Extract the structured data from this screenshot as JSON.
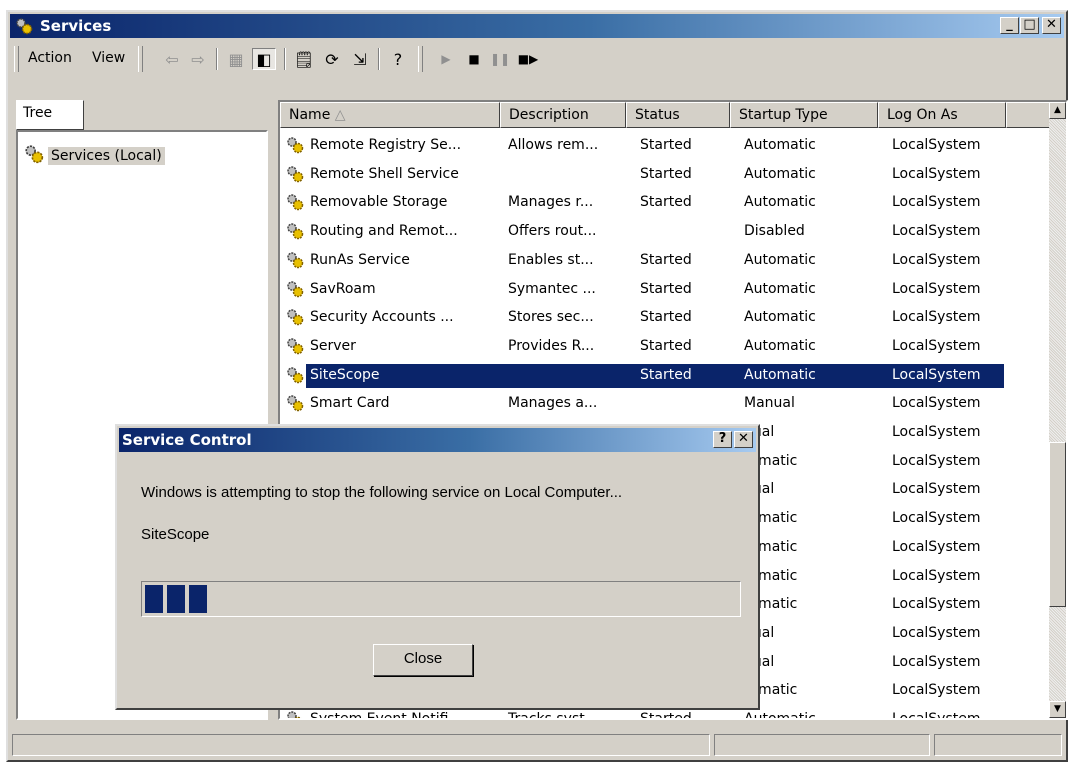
{
  "window": {
    "title": "Services"
  },
  "menu": {
    "action": "Action",
    "view": "View"
  },
  "tree": {
    "tab": "Tree",
    "root": "Services (Local)"
  },
  "columns": [
    "Name",
    "Description",
    "Status",
    "Startup Type",
    "Log On As"
  ],
  "rows": [
    {
      "name": "Remote Registry Se...",
      "desc": "Allows rem...",
      "status": "Started",
      "startup": "Automatic",
      "logon": "LocalSystem"
    },
    {
      "name": "Remote Shell Service",
      "desc": "",
      "status": "Started",
      "startup": "Automatic",
      "logon": "LocalSystem"
    },
    {
      "name": "Removable Storage",
      "desc": "Manages r...",
      "status": "Started",
      "startup": "Automatic",
      "logon": "LocalSystem"
    },
    {
      "name": "Routing and Remot...",
      "desc": "Offers rout...",
      "status": "",
      "startup": "Disabled",
      "logon": "LocalSystem"
    },
    {
      "name": "RunAs Service",
      "desc": "Enables st...",
      "status": "Started",
      "startup": "Automatic",
      "logon": "LocalSystem"
    },
    {
      "name": "SavRoam",
      "desc": "Symantec ...",
      "status": "Started",
      "startup": "Automatic",
      "logon": "LocalSystem"
    },
    {
      "name": "Security Accounts ...",
      "desc": "Stores sec...",
      "status": "Started",
      "startup": "Automatic",
      "logon": "LocalSystem"
    },
    {
      "name": "Server",
      "desc": "Provides R...",
      "status": "Started",
      "startup": "Automatic",
      "logon": "LocalSystem"
    },
    {
      "name": "SiteScope",
      "desc": "",
      "status": "Started",
      "startup": "Automatic",
      "logon": "LocalSystem",
      "selected": true
    },
    {
      "name": "Smart Card",
      "desc": "Manages a...",
      "status": "",
      "startup": "Manual",
      "logon": "LocalSystem"
    },
    {
      "name": "",
      "desc": "",
      "status": "",
      "startup": "nual",
      "logon": "LocalSystem"
    },
    {
      "name": "",
      "desc": "",
      "status": "",
      "startup": "tomatic",
      "logon": "LocalSystem"
    },
    {
      "name": "",
      "desc": "",
      "status": "",
      "startup": "nual",
      "logon": "LocalSystem"
    },
    {
      "name": "",
      "desc": "",
      "status": "",
      "startup": "tomatic",
      "logon": "LocalSystem"
    },
    {
      "name": "",
      "desc": "",
      "status": "",
      "startup": "tomatic",
      "logon": "LocalSystem"
    },
    {
      "name": "",
      "desc": "",
      "status": "",
      "startup": "tomatic",
      "logon": "LocalSystem"
    },
    {
      "name": "",
      "desc": "",
      "status": "",
      "startup": "tomatic",
      "logon": "LocalSystem"
    },
    {
      "name": "",
      "desc": "",
      "status": "",
      "startup": "nual",
      "logon": "LocalSystem"
    },
    {
      "name": "",
      "desc": "",
      "status": "",
      "startup": "nual",
      "logon": "LocalSystem"
    },
    {
      "name": "",
      "desc": "",
      "status": "",
      "startup": "tomatic",
      "logon": "LocalSystem"
    },
    {
      "name": "System Event Notifi...",
      "desc": "Tracks syst...",
      "status": "Started",
      "startup": "Automatic",
      "logon": "LocalSystem"
    }
  ],
  "dialog": {
    "title": "Service Control",
    "message": "Windows is attempting to stop the following service on Local Computer...",
    "service": "SiteScope",
    "close_label": "Close",
    "help": "?",
    "x": "✕",
    "progress_blocks": 3
  },
  "colors": {
    "selection": "#0a246a",
    "face": "#d4d0c8"
  }
}
